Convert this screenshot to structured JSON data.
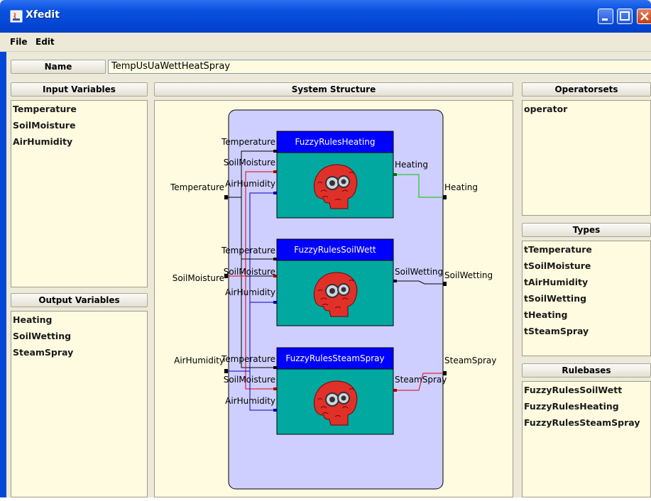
{
  "window": {
    "title": "Xfedit"
  },
  "menu": {
    "file": "File",
    "edit": "Edit"
  },
  "name_row": {
    "label": "Name",
    "value": "TempUsUaWettHeatSpray"
  },
  "input_variables": {
    "header": "Input Variables",
    "items": [
      "Temperature",
      "SoilMoisture",
      "AirHumidity"
    ]
  },
  "output_variables": {
    "header": "Output Variables",
    "items": [
      "Heating",
      "SoilWetting",
      "SteamSpray"
    ]
  },
  "system_structure": {
    "header": "System Structure",
    "external_inputs": [
      "Temperature",
      "SoilMoisture",
      "AirHumidity"
    ],
    "external_outputs": [
      "Heating",
      "SoilWetting",
      "SteamSpray"
    ],
    "modules": [
      {
        "name": "FuzzyRulesHeating",
        "inputs": [
          "Temperature",
          "SoilMoisture",
          "AirHumidity"
        ],
        "output": "Heating"
      },
      {
        "name": "FuzzyRulesSoilWett",
        "inputs": [
          "Temperature",
          "SoilMoisture",
          "AirHumidity"
        ],
        "output": "SoilWetting"
      },
      {
        "name": "FuzzyRulesSteamSpray",
        "inputs": [
          "Temperature",
          "SoilMoisture",
          "AirHumidity"
        ],
        "output": "SteamSpray"
      }
    ]
  },
  "operatorsets": {
    "header": "Operatorsets",
    "items": [
      "operator"
    ]
  },
  "types": {
    "header": "Types",
    "items": [
      "tTemperature",
      "tSoilMoisture",
      "tAirHumidity",
      "tSoilWetting",
      "tHeating",
      "tSteamSpray"
    ]
  },
  "rulebases": {
    "header": "Rulebases",
    "items": [
      "FuzzyRulesSoilWett",
      "FuzzyRulesHeating",
      "FuzzyRulesSteamSpray"
    ]
  },
  "colors": {
    "module_header": "#0000ff",
    "module_body": "#00a8a0",
    "canvas_bg": "#cfcfff",
    "panel_bg": "#fffbe0"
  }
}
